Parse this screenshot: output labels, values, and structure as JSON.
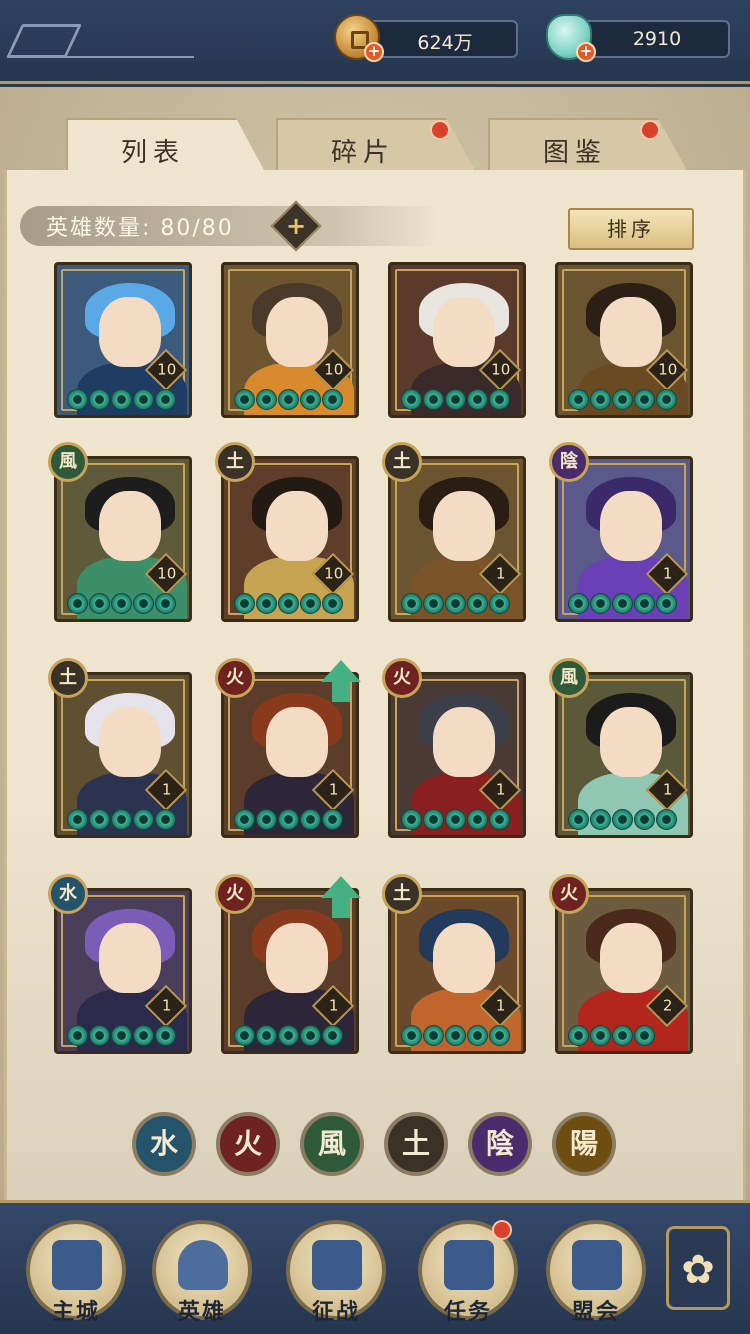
{
  "resources": {
    "coins": "624万",
    "gems": "2910"
  },
  "tabs": [
    {
      "label": "列表",
      "active": true,
      "red_dot": false
    },
    {
      "label": "碎片",
      "active": false,
      "red_dot": true
    },
    {
      "label": "图鉴",
      "active": false,
      "red_dot": true
    }
  ],
  "hero_count": {
    "label": "英雄数量: 80/80",
    "add_label": "+"
  },
  "sort_label": "排序",
  "heroes": [
    {
      "element": "",
      "level": "10",
      "stars": 5,
      "hair": "#5aa9e6",
      "body": "#1f3c63",
      "bg": "#3b5a7c"
    },
    {
      "element": "",
      "level": "10",
      "stars": 5,
      "hair": "#4a3a2c",
      "body": "#d88a2c",
      "bg": "#6d5530"
    },
    {
      "element": "",
      "level": "10",
      "stars": 5,
      "hair": "#e8e4de",
      "body": "#3a2a2a",
      "bg": "#5a3b2b"
    },
    {
      "element": "",
      "level": "10",
      "stars": 5,
      "hair": "#2c2016",
      "body": "#6a4a22",
      "bg": "#6b5430"
    },
    {
      "element": "風",
      "element_class": "wind",
      "level": "10",
      "stars": 5,
      "hair": "#1d1d1d",
      "body": "#3d8f6a",
      "bg": "#5e5a3a"
    },
    {
      "element": "土",
      "element_class": "earth",
      "level": "10",
      "stars": 5,
      "hair": "#241a14",
      "body": "#c7a451",
      "bg": "#5e3d2a"
    },
    {
      "element": "土",
      "element_class": "earth",
      "level": "1",
      "stars": 5,
      "hair": "#2a1e14",
      "body": "#7a5328",
      "bg": "#6b5430"
    },
    {
      "element": "陰",
      "element_class": "yin",
      "level": "1",
      "stars": 5,
      "hair": "#3a2a6a",
      "body": "#6b3fb6",
      "bg": "#5a5a8a"
    },
    {
      "element": "土",
      "element_class": "earth",
      "level": "1",
      "stars": 5,
      "hair": "#e6e2ea",
      "body": "#2c3350",
      "bg": "#5e5030"
    },
    {
      "element": "火",
      "element_class": "fire",
      "level": "1",
      "stars": 5,
      "hair": "#8a3a1c",
      "body": "#2c2638",
      "bg": "#5a3d2a",
      "upgrade": true
    },
    {
      "element": "火",
      "element_class": "fire",
      "level": "1",
      "stars": 5,
      "hair": "#3a3f4a",
      "body": "#8a1f1f",
      "bg": "#4a3a36"
    },
    {
      "element": "風",
      "element_class": "wind",
      "level": "1",
      "stars": 5,
      "hair": "#1b1b1b",
      "body": "#8fc7b3",
      "bg": "#5a5a3a"
    },
    {
      "element": "水",
      "element_class": "water",
      "level": "1",
      "stars": 5,
      "hair": "#7b5cb6",
      "body": "#2c2a4a",
      "bg": "#4a3f5a"
    },
    {
      "element": "火",
      "element_class": "fire",
      "level": "1",
      "stars": 5,
      "hair": "#8a3a1c",
      "body": "#2c2638",
      "bg": "#5a3d2a",
      "upgrade": true
    },
    {
      "element": "土",
      "element_class": "earth",
      "level": "1",
      "stars": 5,
      "hair": "#233a5a",
      "body": "#c0662c",
      "bg": "#6b4a2c"
    },
    {
      "element": "火",
      "element_class": "fire",
      "level": "2",
      "stars": 4,
      "hair": "#4a2a1a",
      "body": "#b3261e",
      "bg": "#6b5c40"
    }
  ],
  "filters": [
    {
      "glyph": "水",
      "cls": "water",
      "name": "water-filter"
    },
    {
      "glyph": "火",
      "cls": "fire",
      "name": "fire-filter"
    },
    {
      "glyph": "風",
      "cls": "wind",
      "name": "wind-filter"
    },
    {
      "glyph": "土",
      "cls": "earth",
      "name": "earth-filter"
    },
    {
      "glyph": "陰",
      "cls": "yin",
      "name": "yin-filter"
    },
    {
      "glyph": "陽",
      "cls": "yang",
      "name": "yang-filter"
    }
  ],
  "nav": [
    {
      "label": "主城",
      "name": "nav-main-city"
    },
    {
      "label": "英雄",
      "name": "nav-heroes",
      "active": true
    },
    {
      "label": "征战",
      "name": "nav-campaign"
    },
    {
      "label": "任务",
      "name": "nav-quests",
      "red_dot": true
    },
    {
      "label": "盟会",
      "name": "nav-guild"
    }
  ],
  "menu_icon": "✿"
}
